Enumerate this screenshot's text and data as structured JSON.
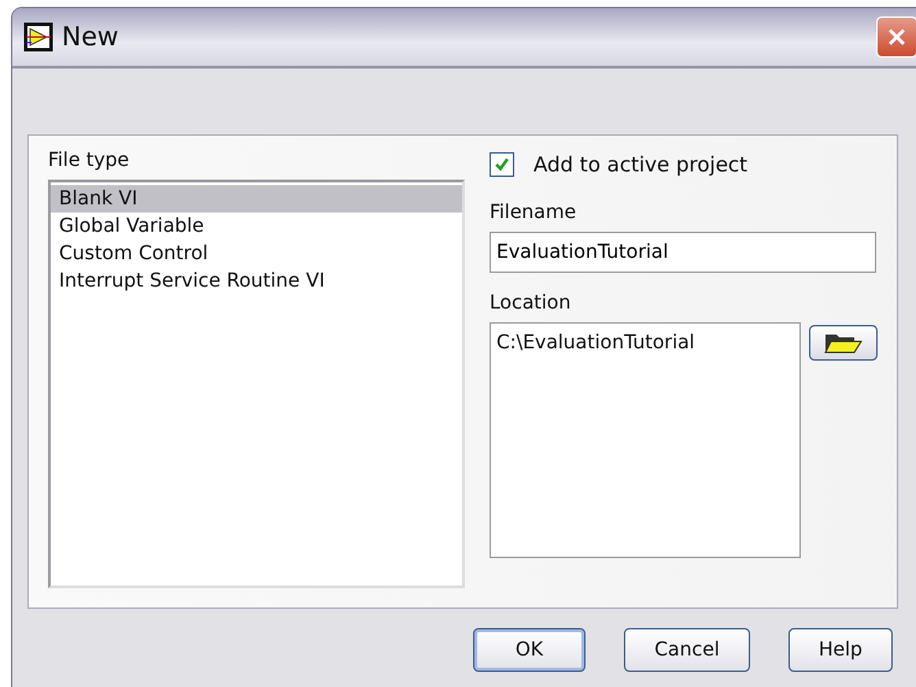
{
  "window": {
    "title": "New"
  },
  "file_type": {
    "label": "File type",
    "items": [
      {
        "label": "Blank VI",
        "selected": true
      },
      {
        "label": "Global Variable",
        "selected": false
      },
      {
        "label": "Custom Control",
        "selected": false
      },
      {
        "label": "Interrupt Service Routine VI",
        "selected": false
      }
    ]
  },
  "add_to_project": {
    "label": "Add to active project",
    "checked": true
  },
  "filename": {
    "label": "Filename",
    "value": "EvaluationTutorial"
  },
  "location": {
    "label": "Location",
    "value": "C:\\EvaluationTutorial"
  },
  "buttons": [
    {
      "label": "OK",
      "default": true
    },
    {
      "label": "Cancel",
      "default": false
    },
    {
      "label": "Help",
      "default": false
    }
  ]
}
